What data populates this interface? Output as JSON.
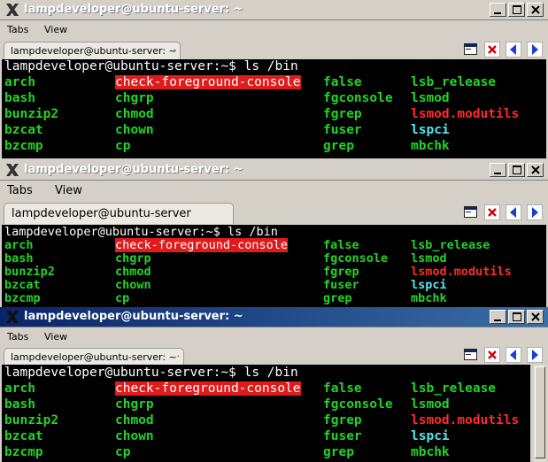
{
  "windows": [
    {
      "title": "lampdeveloper@ubuntu-server: ~",
      "active": false,
      "menu": [
        "Tabs",
        "View"
      ],
      "tab": {
        "label": "lampdeveloper@ubuntu-server: ~",
        "close_glyph": "·"
      },
      "terminal": {
        "prompt": "lampdeveloper@ubuntu-server:~$ ls /bin",
        "rows": [
          [
            "arch",
            "check-foreground-console",
            "false",
            "lsb_release"
          ],
          [
            "bash",
            "chgrp",
            "fgconsole",
            "lsmod"
          ],
          [
            "bunzip2",
            "chmod",
            "fgrep",
            "lsmod.modutils"
          ],
          [
            "bzcat",
            "chown",
            "fuser",
            "lspci"
          ],
          [
            "bzcmp",
            "cp",
            "grep",
            "mbchk"
          ]
        ]
      }
    },
    {
      "title": "lampdeveloper@ubuntu-server: ~",
      "active": false,
      "menu": [
        "Tabs",
        "View"
      ],
      "tab": {
        "label": "lampdeveloper@ubuntu-server"
      },
      "terminal": {
        "prompt": "lampdeveloper@ubuntu-server:~$ ls /bin",
        "rows": [
          [
            "arch",
            "check-foreground-console",
            "false",
            "lsb_release"
          ],
          [
            "bash",
            "chgrp",
            "fgconsole",
            "lsmod"
          ],
          [
            "bunzip2",
            "chmod",
            "fgrep",
            "lsmod.modutils"
          ],
          [
            "bzcat",
            "chown",
            "fuser",
            "lspci"
          ],
          [
            "bzcmp",
            "cp",
            "grep",
            "mbchk"
          ]
        ]
      }
    },
    {
      "title": "lampdeveloper@ubuntu-server: ~",
      "active": true,
      "menu": [
        "Tabs",
        "View"
      ],
      "tab": {
        "label": "lampdeveloper@ubuntu-server: ~",
        "close_glyph": "·"
      },
      "terminal": {
        "prompt": "lampdeveloper@ubuntu-server:~$ ls /bin",
        "rows": [
          [
            "arch",
            "check-foreground-console",
            "false",
            "lsb_release"
          ],
          [
            "bash",
            "chgrp",
            "fgconsole",
            "lsmod"
          ],
          [
            "bunzip2",
            "chmod",
            "fgrep",
            "lsmod.modutils"
          ],
          [
            "bzcat",
            "chown",
            "fuser",
            "lspci"
          ],
          [
            "bzcmp",
            "cp",
            "grep",
            "mbchk"
          ]
        ]
      }
    }
  ],
  "colors": {
    "active_title": "#0a246a",
    "terminal_bg": "#000000",
    "executable_text": "#21d426",
    "highlight_bg": "#e01b1b",
    "red_text": "#ff2a2a",
    "cyan_text": "#55e6ee"
  },
  "icons": {
    "app": "x-logo-icon",
    "minimize": "minimize-icon",
    "maximize": "maximize-icon",
    "close": "close-icon",
    "new_tab": "new-tab-icon",
    "close_tab": "close-tab-icon",
    "prev_tab": "prev-tab-icon",
    "next_tab": "next-tab-icon"
  }
}
